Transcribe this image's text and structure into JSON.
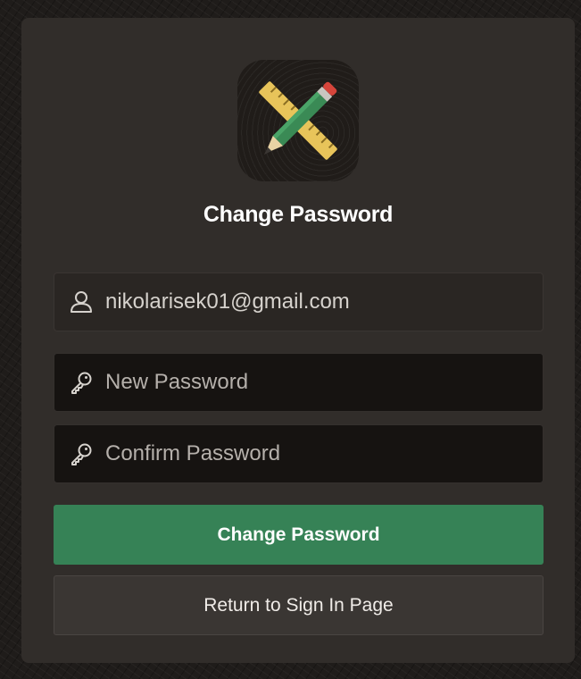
{
  "page": {
    "title": "Change Password"
  },
  "logo": {
    "icon": "pencil-ruler-icon"
  },
  "form": {
    "username_value": "nikolarisek01@gmail.com",
    "username_icon": "user-icon",
    "new_password_placeholder": "New Password",
    "confirm_password_placeholder": "Confirm Password",
    "password_icon": "key-icon"
  },
  "buttons": {
    "change_password_label": "Change Password",
    "return_label": "Return to Sign In Page"
  },
  "colors": {
    "primary_button": "#368256",
    "card_background": "#312d2a",
    "page_background": "#1f1c1a"
  }
}
